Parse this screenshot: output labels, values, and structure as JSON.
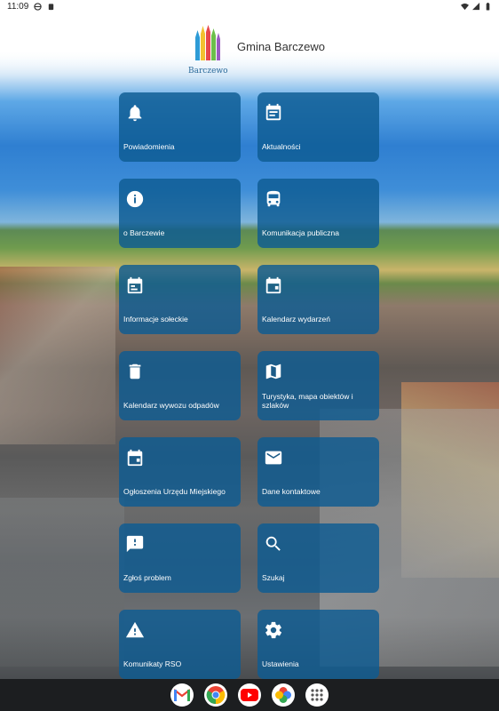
{
  "status_bar": {
    "time": "11:09",
    "icons": [
      "vpn-icon",
      "clipboard-icon",
      "wifi-icon",
      "signal-icon",
      "battery-icon"
    ]
  },
  "header": {
    "logo_text": "Barczewo",
    "app_title": "Gmina Barczewo"
  },
  "tiles": [
    {
      "label": "Powiadomienia",
      "icon": "bell-icon"
    },
    {
      "label": "Aktualności",
      "icon": "news-icon"
    },
    {
      "label": "o Barczewie",
      "icon": "info-icon"
    },
    {
      "label": "Komunikacja publiczna",
      "icon": "bus-icon"
    },
    {
      "label": "Informacje sołeckie",
      "icon": "calendar-icon"
    },
    {
      "label": "Kalendarz wydarzeń",
      "icon": "calendar-event-icon"
    },
    {
      "label": "Kalendarz wywozu odpadów",
      "icon": "trash-icon"
    },
    {
      "label": "Turystyka, mapa obiektów i szlaków",
      "icon": "map-icon"
    },
    {
      "label": "Ogłoszenia Urzędu Miejskiego",
      "icon": "calendar-event-icon"
    },
    {
      "label": "Dane kontaktowe",
      "icon": "mail-icon"
    },
    {
      "label": "Zgłoś problem",
      "icon": "report-icon"
    },
    {
      "label": "Szukaj",
      "icon": "search-icon"
    },
    {
      "label": "Komunikaty RSO",
      "icon": "warning-icon"
    },
    {
      "label": "Ustawienia",
      "icon": "gear-icon"
    }
  ],
  "dock": {
    "apps": [
      "gmail-icon",
      "chrome-icon",
      "youtube-icon",
      "photos-icon",
      "app-drawer-icon"
    ]
  },
  "colors": {
    "tile": "#0e5c92",
    "dock": "#1c1e20"
  }
}
